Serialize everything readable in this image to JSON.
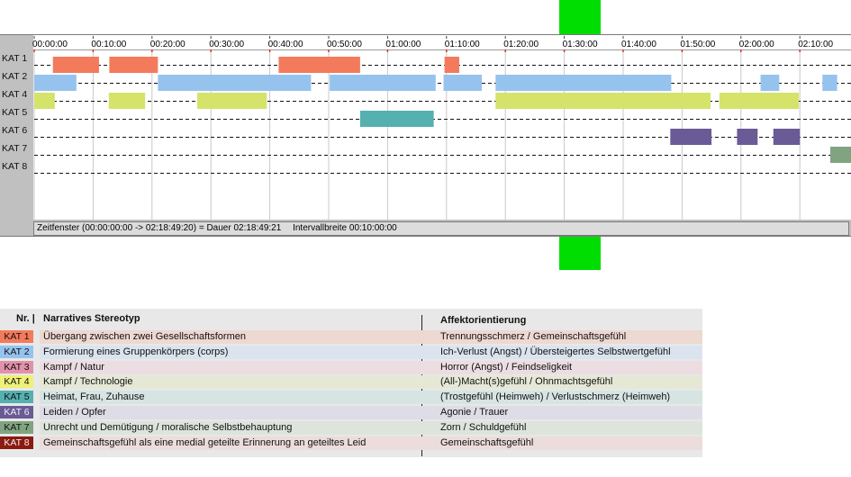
{
  "chart_data": {
    "type": "gantt",
    "x_unit": "hh:mm:ss",
    "xlim": [
      "00:00:00",
      "02:18:49"
    ],
    "tick_labels": [
      "00:00:00",
      "00:10:00",
      "00:20:00",
      "00:30:00",
      "00:40:00",
      "00:50:00",
      "01:00:00",
      "01:10:00",
      "01:20:00",
      "01:30:00",
      "01:40:00",
      "01:50:00",
      "02:00:00",
      "02:10:00"
    ],
    "categories": [
      "KAT 1",
      "KAT 2",
      "KAT 4",
      "KAT 5",
      "KAT 6",
      "KAT 7",
      "KAT 8"
    ],
    "colors": {
      "KAT 1": "#f47a5c",
      "KAT 2": "#96c3ee",
      "KAT 4": "#d5e36b",
      "KAT 5": "#55b0b0",
      "KAT 6": "#6a5a96",
      "KAT 7": "#80a480",
      "KAT 8": "#8b1a10"
    },
    "segments": [
      {
        "cat": "KAT 1",
        "start": "00:03:10",
        "end": "00:11:00"
      },
      {
        "cat": "KAT 1",
        "start": "00:12:45",
        "end": "00:21:00"
      },
      {
        "cat": "KAT 1",
        "start": "00:41:30",
        "end": "00:55:20"
      },
      {
        "cat": "KAT 1",
        "start": "01:09:40",
        "end": "01:12:10"
      },
      {
        "cat": "KAT 2",
        "start": "00:00:00",
        "end": "00:07:10"
      },
      {
        "cat": "KAT 2",
        "start": "00:21:00",
        "end": "00:47:00"
      },
      {
        "cat": "KAT 2",
        "start": "00:50:10",
        "end": "01:08:10"
      },
      {
        "cat": "KAT 2",
        "start": "01:09:30",
        "end": "01:16:00"
      },
      {
        "cat": "KAT 2",
        "start": "01:18:20",
        "end": "01:48:10"
      },
      {
        "cat": "KAT 2",
        "start": "02:03:20",
        "end": "02:06:30"
      },
      {
        "cat": "KAT 2",
        "start": "02:13:50",
        "end": "02:16:20"
      },
      {
        "cat": "KAT 4",
        "start": "00:00:00",
        "end": "00:03:30"
      },
      {
        "cat": "KAT 4",
        "start": "00:12:40",
        "end": "00:18:50"
      },
      {
        "cat": "KAT 4",
        "start": "00:27:40",
        "end": "00:39:30"
      },
      {
        "cat": "KAT 4",
        "start": "01:18:20",
        "end": "01:54:50"
      },
      {
        "cat": "KAT 4",
        "start": "01:56:20",
        "end": "02:09:50"
      },
      {
        "cat": "KAT 5",
        "start": "00:55:20",
        "end": "01:07:50"
      },
      {
        "cat": "KAT 6",
        "start": "01:48:00",
        "end": "01:55:00"
      },
      {
        "cat": "KAT 6",
        "start": "01:59:20",
        "end": "02:02:50"
      },
      {
        "cat": "KAT 6",
        "start": "02:05:30",
        "end": "02:10:00"
      },
      {
        "cat": "KAT 7",
        "start": "02:15:10",
        "end": "02:18:49"
      }
    ]
  },
  "timeline": {
    "footer": {
      "window": "Zeitfenster (00:00:00:00 -> 02:18:49:20) = Dauer 02:18:49:21",
      "interval": "Intervallbreite 00:10:00:00"
    }
  },
  "legend": {
    "headers": {
      "nr": "Nr. |",
      "stereotype": "Narratives Stereotyp",
      "affect": "Affektorientierung"
    },
    "rows": [
      {
        "code": "KAT 1",
        "color": "#f47a5c",
        "bg": "#eed8d2",
        "stereotype": "Übergang zwischen zwei Gesellschaftsformen",
        "affect": "Trennungsschmerz / Gemeinschaftsgefühl"
      },
      {
        "code": "KAT 2",
        "color": "#96c3ee",
        "bg": "#dbe3ee",
        "stereotype": "Formierung eines Gruppenkörpers (corps)",
        "affect": "Ich-Verlust (Angst) / Übersteigertes Selbstwertgefühl"
      },
      {
        "code": "KAT 3",
        "color": "#e291aa",
        "bg": "#ecdde2",
        "stereotype": "Kampf / Natur",
        "affect": "Horror (Angst) / Feindseligkeit"
      },
      {
        "code": "KAT 4",
        "color": "#eef078",
        "bg": "#e6e8d6",
        "stereotype": "Kampf / Technologie",
        "affect": "(All-)Macht(s)gefühl / Ohnmachtsgefühl"
      },
      {
        "code": "KAT 5",
        "color": "#55b0b0",
        "bg": "#d6e4e2",
        "stereotype": "Heimat, Frau, Zuhause",
        "affect": "(Trostgefühl (Heimweh) / Verlustschmerz (Heimweh)"
      },
      {
        "code": "KAT 6",
        "color": "#6a5a96",
        "bg": "#dedce6",
        "stereotype": "Leiden / Opfer",
        "affect": "Agonie / Trauer"
      },
      {
        "code": "KAT 7",
        "color": "#80a480",
        "bg": "#dde4dc",
        "stereotype": "Unrecht und Demütigung / moralische Selbstbehauptung",
        "affect": "Zorn / Schuldgefühl"
      },
      {
        "code": "KAT 8",
        "color": "#8b1a10",
        "bg": "#ecdcdc",
        "stereotype": "Gemeinschaftsgefühl als eine medial geteilte Erinnerung an geteiltes Leid",
        "affect": "Gemeinschaftsgefühl"
      }
    ]
  }
}
